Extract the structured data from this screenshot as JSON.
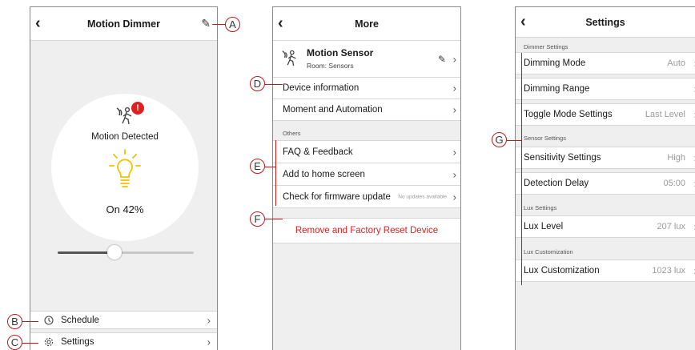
{
  "screen1": {
    "title": "Motion Dimmer",
    "status_text": "Motion Detected",
    "alert_badge": "!",
    "level_text": "On 42%",
    "brightness_level": 0.42,
    "rows": [
      {
        "label": "Schedule",
        "icon": "clock-icon"
      },
      {
        "label": "Settings",
        "icon": "gear-icon"
      }
    ]
  },
  "screen2": {
    "title": "More",
    "device": {
      "name": "Motion Sensor",
      "room": "Room: Sensors"
    },
    "rows_top": [
      "Device information",
      "Moment and Automation"
    ],
    "section_others": "Others",
    "rows_others": [
      "FAQ & Feedback",
      "Add to home screen"
    ],
    "firmware": {
      "label": "Check for firmware update",
      "note": "No updates available"
    },
    "remove_label": "Remove and Factory Reset Device"
  },
  "screen3": {
    "title": "Settings",
    "sections": [
      {
        "label": "Dimmer Settings",
        "rows": [
          {
            "label": "Dimming Mode",
            "value": "Auto"
          },
          {
            "label": "Dimming Range",
            "value": ""
          },
          {
            "label": "Toggle Mode Settings",
            "value": "Last Level"
          }
        ]
      },
      {
        "label": "Sensor Settings",
        "rows": [
          {
            "label": "Sensitivity Settings",
            "value": "High"
          },
          {
            "label": "Detection Delay",
            "value": "05:00"
          }
        ]
      },
      {
        "label": "Lux Settings",
        "rows": [
          {
            "label": "Lux Level",
            "value": "207 lux"
          }
        ]
      },
      {
        "label": "Lux Customization",
        "rows": [
          {
            "label": "Lux Customization",
            "value": "1023 lux"
          }
        ]
      }
    ]
  },
  "callouts": {
    "a": "A",
    "b": "B",
    "c": "C",
    "d": "D",
    "e": "E",
    "f": "F",
    "g": "G"
  },
  "colors": {
    "accent_red": "#e02020",
    "bulb_yellow": "#f2c200",
    "callout": "#c01818"
  }
}
